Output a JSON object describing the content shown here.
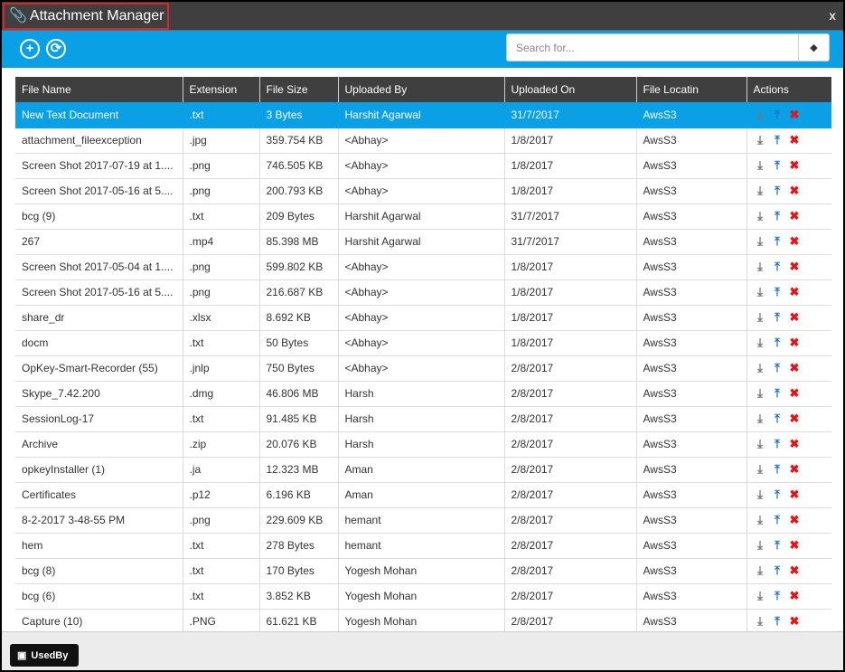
{
  "window": {
    "title": "Attachment Manager",
    "close": "x"
  },
  "toolbar": {
    "add": "+",
    "refresh": "⟳",
    "search_placeholder": "Search for...",
    "search_value": ""
  },
  "table": {
    "columns": [
      "File Name",
      "Extension",
      "File Size",
      "Uploaded By",
      "Uploaded On",
      "File Locatin",
      "Actions"
    ],
    "rows": [
      [
        "New Text Document",
        ".txt",
        "3 Bytes",
        "Harshit Agarwal",
        "31/7/2017",
        "AwsS3"
      ],
      [
        "attachment_fileexception",
        ".jpg",
        "359.754 KB",
        "<Abhay>",
        "1/8/2017",
        "AwsS3"
      ],
      [
        "Screen Shot 2017-07-19 at 1....",
        ".png",
        "746.505 KB",
        "<Abhay>",
        "1/8/2017",
        "AwsS3"
      ],
      [
        "Screen Shot 2017-05-16 at 5....",
        ".png",
        "200.793 KB",
        "<Abhay>",
        "1/8/2017",
        "AwsS3"
      ],
      [
        "bcg (9)",
        ".txt",
        "209 Bytes",
        "Harshit Agarwal",
        "31/7/2017",
        "AwsS3"
      ],
      [
        "267",
        ".mp4",
        "85.398 MB",
        "Harshit Agarwal",
        "31/7/2017",
        "AwsS3"
      ],
      [
        "Screen Shot 2017-05-04 at 1....",
        ".png",
        "599.802 KB",
        "<Abhay>",
        "1/8/2017",
        "AwsS3"
      ],
      [
        "Screen Shot 2017-05-16 at 5....",
        ".png",
        "216.687 KB",
        "<Abhay>",
        "1/8/2017",
        "AwsS3"
      ],
      [
        "share_dr",
        ".xlsx",
        "8.692 KB",
        "<Abhay>",
        "1/8/2017",
        "AwsS3"
      ],
      [
        "docm",
        ".txt",
        "50 Bytes",
        "<Abhay>",
        "1/8/2017",
        "AwsS3"
      ],
      [
        "OpKey-Smart-Recorder (55)",
        ".jnlp",
        "750 Bytes",
        "<Abhay>",
        "2/8/2017",
        "AwsS3"
      ],
      [
        "Skype_7.42.200",
        ".dmg",
        "46.806 MB",
        "Harsh",
        "2/8/2017",
        "AwsS3"
      ],
      [
        "SessionLog-17",
        ".txt",
        "91.485 KB",
        "Harsh",
        "2/8/2017",
        "AwsS3"
      ],
      [
        "Archive",
        ".zip",
        "20.076 KB",
        "Harsh",
        "2/8/2017",
        "AwsS3"
      ],
      [
        "opkeyInstaller (1)",
        ".ja",
        "12.323 MB",
        "Aman",
        "2/8/2017",
        "AwsS3"
      ],
      [
        "Certificates",
        ".p12",
        "6.196 KB",
        "Aman",
        "2/8/2017",
        "AwsS3"
      ],
      [
        "8-2-2017 3-48-55 PM",
        ".png",
        "229.609 KB",
        "hemant",
        "2/8/2017",
        "AwsS3"
      ],
      [
        "hem",
        ".txt",
        "278 Bytes",
        "hemant",
        "2/8/2017",
        "AwsS3"
      ],
      [
        "bcg (8)",
        ".txt",
        "170 Bytes",
        "Yogesh Mohan",
        "2/8/2017",
        "AwsS3"
      ],
      [
        "bcg (6)",
        ".txt",
        "3.852 KB",
        "Yogesh Mohan",
        "2/8/2017",
        "AwsS3"
      ],
      [
        "Capture (10)",
        ".PNG",
        "61.621 KB",
        "Yogesh Mohan",
        "2/8/2017",
        "AwsS3"
      ]
    ],
    "selected_row": 0
  },
  "footer": {
    "usedby": "UsedBy"
  }
}
